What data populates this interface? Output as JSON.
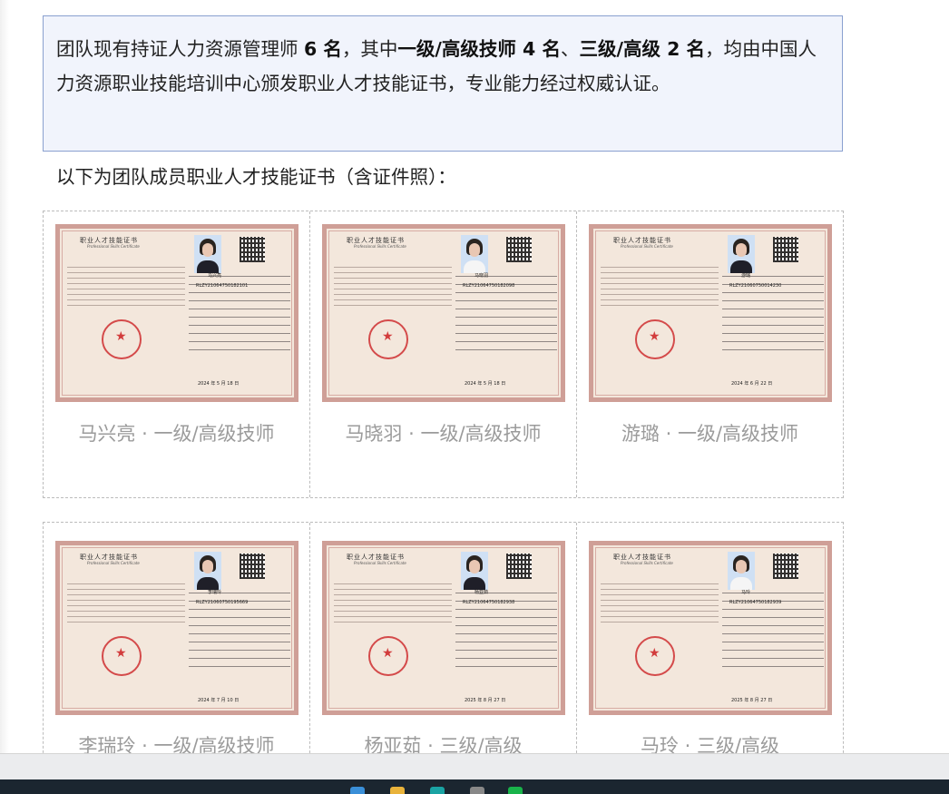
{
  "intro": {
    "p1": "团队现有持证人力资源管理师 ",
    "b1": "6 名",
    "p2": "，其中",
    "b2": "一级/高级技师 4 名",
    "p3": "、",
    "b3": "三级/高级 2 名",
    "p4": "，均由中国人力资源职业技能培训中心颁发职业人才技能证书，专业能力经过权威认证。"
  },
  "subheading": "以下为团队成员职业人才技能证书（含证件照）：",
  "certificate_template": {
    "title": "职业人才技能证书",
    "subtitle": "Professional Skills Certificate",
    "seal_glyph": "★"
  },
  "certificates": [
    {
      "name": "马兴亮",
      "number": "RLZY21064750182101",
      "date": "2024 年 5 月 18 日",
      "caption": "马兴亮 · 一级/高级技师"
    },
    {
      "name": "马晓羽",
      "number": "RLZY21064750182098",
      "date": "2024 年 5 月 18 日",
      "caption": "马晓羽 · 一级/高级技师"
    },
    {
      "name": "游璐",
      "number": "RLZY21060750014230",
      "date": "2024 年 6 月 22 日",
      "caption": "游璐 · 一级/高级技师"
    },
    {
      "name": "李瑞玲",
      "number": "RLZY21060750195669",
      "date": "2024 年 7 月 10 日",
      "caption": "李瑞玲 · 一级/高级技师"
    },
    {
      "name": "杨亚茹",
      "number": "RLZY21064750182938",
      "date": "2025 年 8 月 27 日",
      "caption": "杨亚茹 · 三级/高级"
    },
    {
      "name": "马玲",
      "number": "RLZY21064750182939",
      "date": "2025 年 8 月 27 日",
      "caption": "马玲 · 三级/高级"
    }
  ],
  "colors": {
    "accent_border": "#8aa0cf",
    "caption_gray": "#9b9b9b",
    "seal_red": "#d23c3c"
  }
}
